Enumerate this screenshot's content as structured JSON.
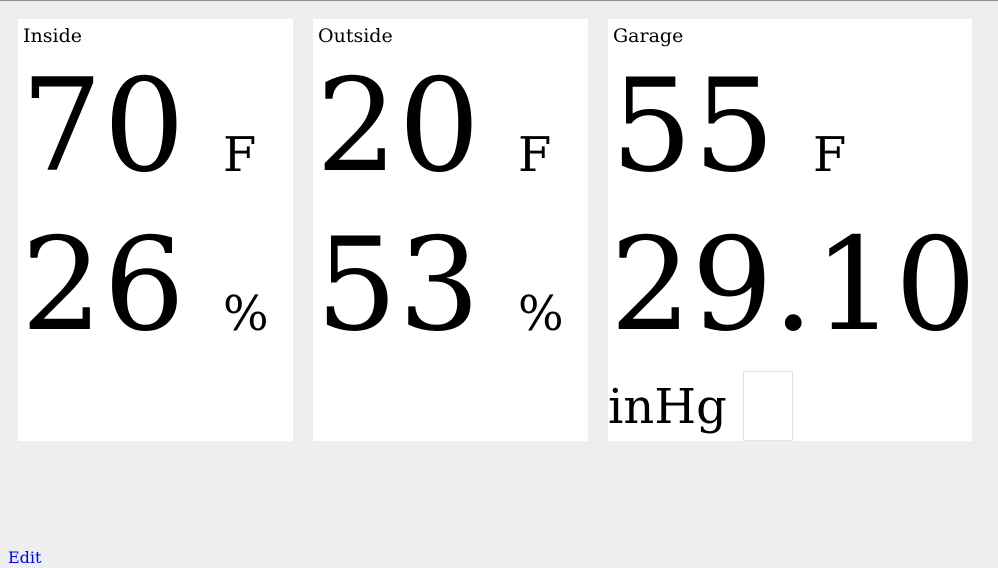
{
  "panels": [
    {
      "title": "Inside",
      "temperature": {
        "value": "70",
        "unit": "F"
      },
      "humidity": {
        "value": "26",
        "unit": "%"
      }
    },
    {
      "title": "Outside",
      "temperature": {
        "value": "20",
        "unit": "F"
      },
      "humidity": {
        "value": "53",
        "unit": "%"
      }
    },
    {
      "title": "Garage",
      "temperature": {
        "value": "55",
        "unit": "F"
      },
      "pressure": {
        "value": "29.10",
        "unit": "inHg"
      }
    }
  ],
  "footer": {
    "edit_label": "Edit"
  },
  "colors": {
    "page_background": "#eeeeee",
    "panel_background": "#ffffff",
    "text": "#000000",
    "link": "#0000ee"
  }
}
